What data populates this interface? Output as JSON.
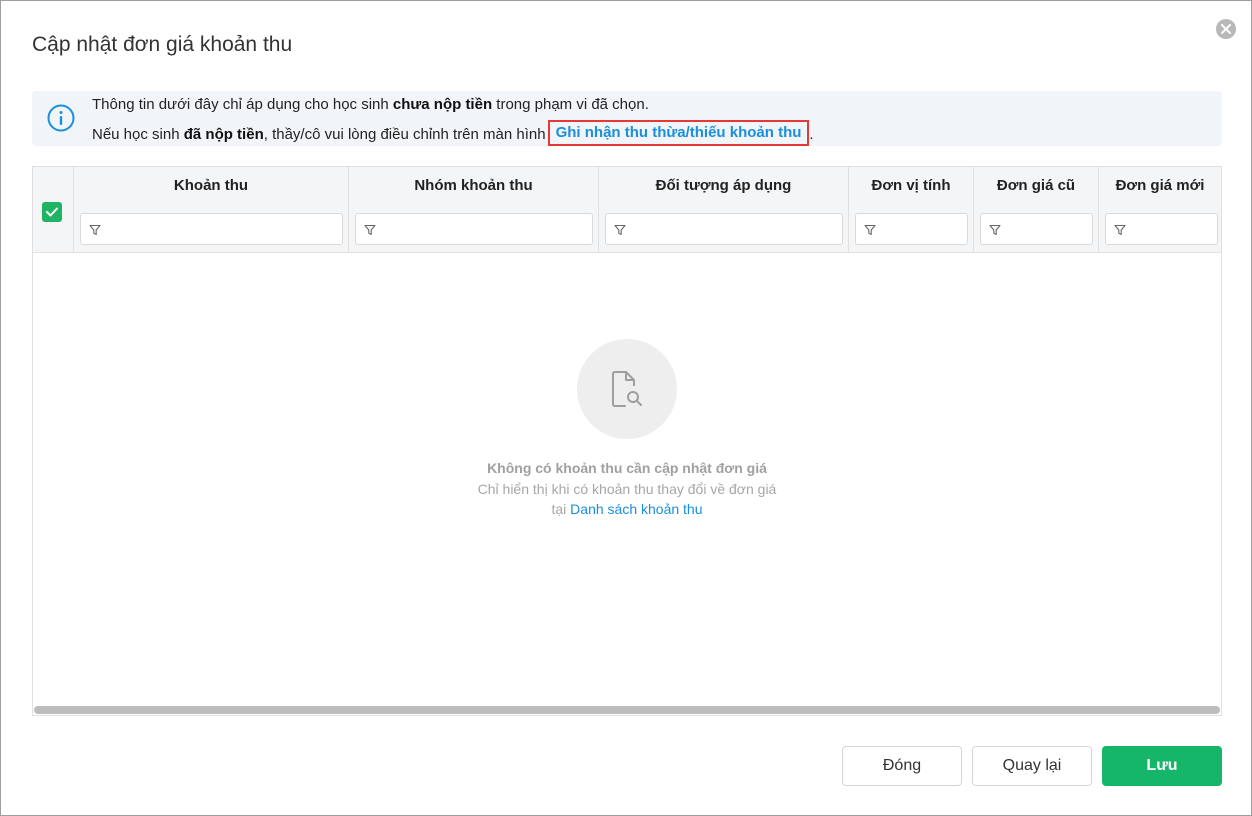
{
  "dialog": {
    "title": "Cập nhật đơn giá khoản thu",
    "close_icon": "close-icon"
  },
  "info": {
    "icon": "info-icon",
    "line1_before": "Thông tin dưới đây chỉ áp dụng cho học sinh ",
    "line1_bold": "chưa nộp tiền",
    "line1_after": " trong phạm vi đã chọn.",
    "line2_before": "Nếu học sinh ",
    "line2_bold": "đã nộp tiền",
    "line2_middle": ", thầy/cô vui lòng điều chỉnh trên màn hình",
    "line2_link": "Ghi nhận thu thừa/thiếu khoản thu",
    "line2_after": "."
  },
  "table": {
    "columns": [
      {
        "label": "Khoản thu"
      },
      {
        "label": "Nhóm khoản thu"
      },
      {
        "label": "Đối tượng áp dụng"
      },
      {
        "label": "Đơn vị tính"
      },
      {
        "label": "Đơn giá cũ"
      },
      {
        "label": "Đơn giá mới"
      }
    ],
    "select_all_checked": true,
    "filter_icon": "filter-icon",
    "empty": {
      "icon": "file-search-icon",
      "title": "Không có khoản thu cần cập nhật đơn giá",
      "subtitle": "Chỉ hiển thị khi có khoản thu thay đổi về đơn giá",
      "subtitle2_prefix": "tại ",
      "subtitle2_link": "Danh sách khoản thu"
    }
  },
  "footer": {
    "close_label": "Đóng",
    "back_label": "Quay lại",
    "save_label": "Lưu"
  },
  "colors": {
    "primary": "#16b66a",
    "link": "#1a8fdb",
    "highlight_border": "#e53935"
  }
}
